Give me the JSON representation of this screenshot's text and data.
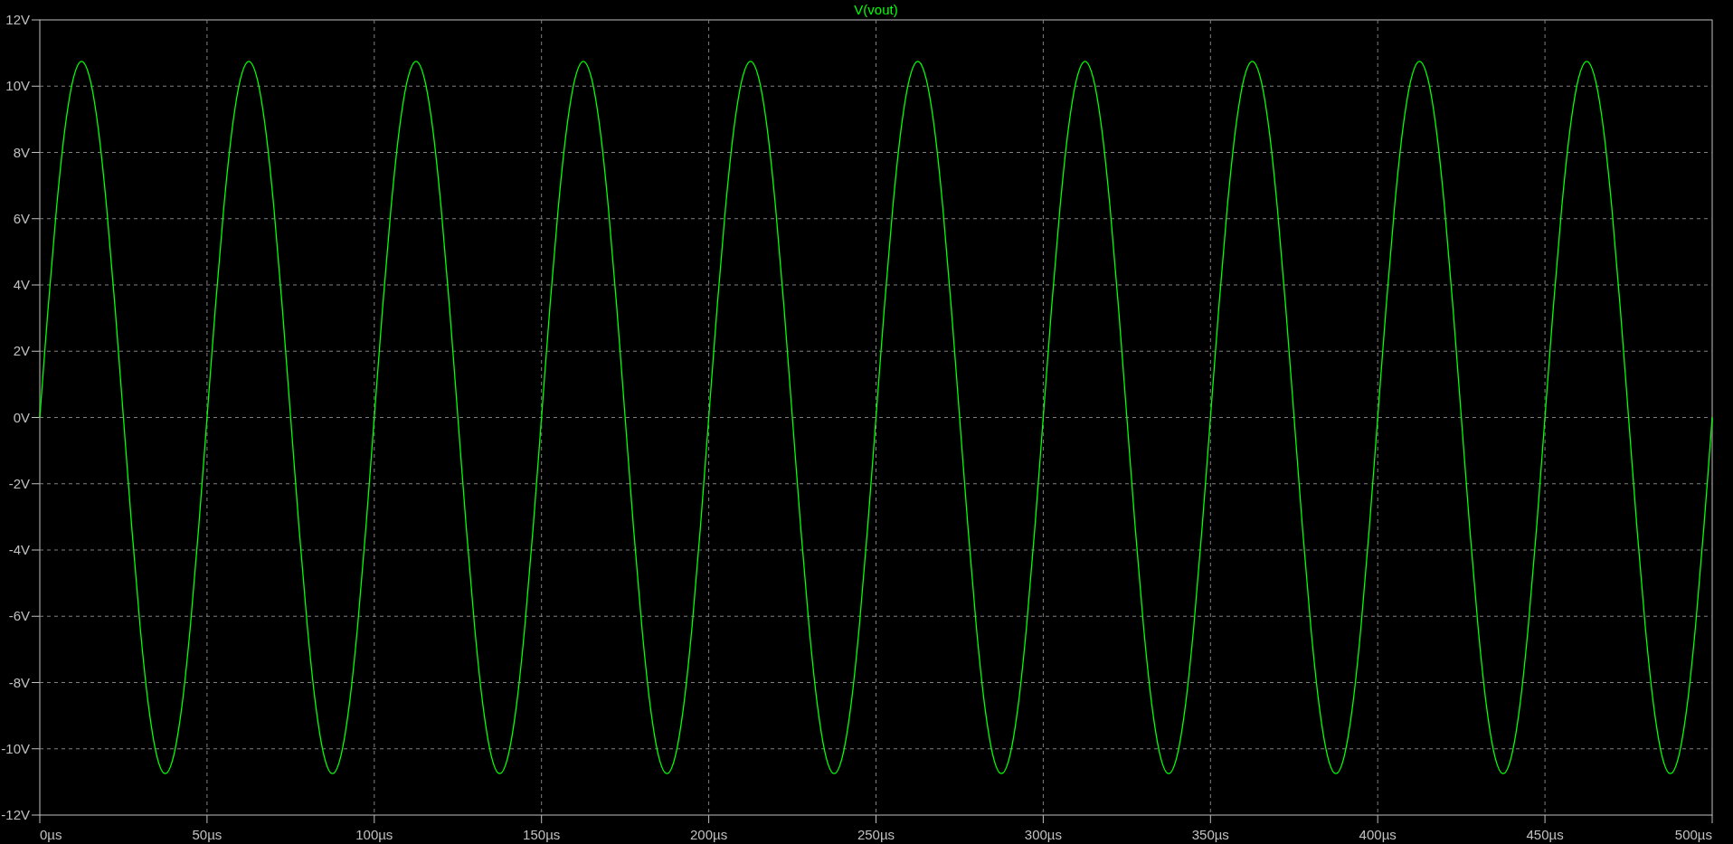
{
  "plot": {
    "chart_data": {
      "type": "line",
      "grid": true,
      "xlim": [
        0,
        500
      ],
      "ylim": [
        -12,
        12
      ],
      "xticks": [
        {
          "value": 0,
          "label": "0µs"
        },
        {
          "value": 50,
          "label": "50µs"
        },
        {
          "value": 100,
          "label": "100µs"
        },
        {
          "value": 150,
          "label": "150µs"
        },
        {
          "value": 200,
          "label": "200µs"
        },
        {
          "value": 250,
          "label": "250µs"
        },
        {
          "value": 300,
          "label": "300µs"
        },
        {
          "value": 350,
          "label": "350µs"
        },
        {
          "value": 400,
          "label": "400µs"
        },
        {
          "value": 450,
          "label": "450µs"
        },
        {
          "value": 500,
          "label": "500µs"
        }
      ],
      "yticks": [
        {
          "value": 12,
          "label": "12V"
        },
        {
          "value": 10,
          "label": "10V"
        },
        {
          "value": 8,
          "label": "8V"
        },
        {
          "value": 6,
          "label": "6V"
        },
        {
          "value": 4,
          "label": "4V"
        },
        {
          "value": 2,
          "label": "2V"
        },
        {
          "value": 0,
          "label": "0V"
        },
        {
          "value": -2,
          "label": "-2V"
        },
        {
          "value": -4,
          "label": "-4V"
        },
        {
          "value": -6,
          "label": "-6V"
        },
        {
          "value": -8,
          "label": "-8V"
        },
        {
          "value": -10,
          "label": "-10V"
        },
        {
          "value": -12,
          "label": "-12V"
        }
      ],
      "x": [
        0,
        2.5,
        5,
        7.5,
        10,
        12.5,
        15,
        17.5,
        20,
        22.5,
        25,
        27.5,
        30,
        32.5,
        35,
        37.5,
        40,
        42.5,
        45,
        47.5,
        50,
        52.5,
        55,
        57.5,
        60,
        62.5,
        65,
        67.5,
        70,
        72.5,
        75,
        77.5,
        80,
        82.5,
        85,
        87.5,
        90,
        92.5,
        95,
        97.5,
        100,
        102.5,
        105,
        107.5,
        110,
        112.5,
        115,
        117.5,
        120,
        122.5,
        125,
        127.5,
        130,
        132.5,
        135,
        137.5,
        140,
        142.5,
        145,
        147.5,
        150,
        152.5,
        155,
        157.5,
        160,
        162.5,
        165,
        167.5,
        170,
        172.5,
        175,
        177.5,
        180,
        182.5,
        185,
        187.5,
        190,
        192.5,
        195,
        197.5,
        200,
        202.5,
        205,
        207.5,
        210,
        212.5,
        215,
        217.5,
        220,
        222.5,
        225,
        227.5,
        230,
        232.5,
        235,
        237.5,
        240,
        242.5,
        245,
        247.5,
        250,
        252.5,
        255,
        257.5,
        260,
        262.5,
        265,
        267.5,
        270,
        272.5,
        275,
        277.5,
        280,
        282.5,
        285,
        287.5,
        290,
        292.5,
        295,
        297.5,
        300,
        302.5,
        305,
        307.5,
        310,
        312.5,
        315,
        317.5,
        320,
        322.5,
        325,
        327.5,
        330,
        332.5,
        335,
        337.5,
        340,
        342.5,
        345,
        347.5,
        350,
        352.5,
        355,
        357.5,
        360,
        362.5,
        365,
        367.5,
        370,
        372.5,
        375,
        377.5,
        380,
        382.5,
        385,
        387.5,
        390,
        392.5,
        395,
        397.5,
        400,
        402.5,
        405,
        407.5,
        410,
        412.5,
        415,
        417.5,
        420,
        422.5,
        425,
        427.5,
        430,
        432.5,
        435,
        437.5,
        440,
        442.5,
        445,
        447.5,
        450,
        452.5,
        455,
        457.5,
        460,
        462.5,
        465,
        467.5,
        470,
        472.5,
        475,
        477.5,
        480,
        482.5,
        485,
        487.5,
        490,
        492.5,
        495,
        497.5,
        500
      ],
      "series": [
        {
          "name": "V(vout)",
          "color": "#00ff00",
          "values": [
            0,
            3.32,
            6.32,
            8.7,
            10.22,
            10.75,
            10.22,
            8.7,
            6.32,
            3.32,
            0,
            -3.32,
            -6.32,
            -8.7,
            -10.22,
            -10.75,
            -10.22,
            -8.7,
            -6.32,
            -3.32,
            0,
            3.32,
            6.32,
            8.7,
            10.22,
            10.75,
            10.22,
            8.7,
            6.32,
            3.32,
            0,
            -3.32,
            -6.32,
            -8.7,
            -10.22,
            -10.75,
            -10.22,
            -8.7,
            -6.32,
            -3.32,
            0,
            3.32,
            6.32,
            8.7,
            10.22,
            10.75,
            10.22,
            8.7,
            6.32,
            3.32,
            0,
            -3.32,
            -6.32,
            -8.7,
            -10.22,
            -10.75,
            -10.22,
            -8.7,
            -6.32,
            -3.32,
            0,
            3.32,
            6.32,
            8.7,
            10.22,
            10.75,
            10.22,
            8.7,
            6.32,
            3.32,
            0,
            -3.32,
            -6.32,
            -8.7,
            -10.22,
            -10.75,
            -10.22,
            -8.7,
            -6.32,
            -3.32,
            0,
            3.32,
            6.32,
            8.7,
            10.22,
            10.75,
            10.22,
            8.7,
            6.32,
            3.32,
            0,
            -3.32,
            -6.32,
            -8.7,
            -10.22,
            -10.75,
            -10.22,
            -8.7,
            -6.32,
            -3.32,
            0,
            3.32,
            6.32,
            8.7,
            10.22,
            10.75,
            10.22,
            8.7,
            6.32,
            3.32,
            0,
            -3.32,
            -6.32,
            -8.7,
            -10.22,
            -10.75,
            -10.22,
            -8.7,
            -6.32,
            -3.32,
            0,
            3.32,
            6.32,
            8.7,
            10.22,
            10.75,
            10.22,
            8.7,
            6.32,
            3.32,
            0,
            -3.32,
            -6.32,
            -8.7,
            -10.22,
            -10.75,
            -10.22,
            -8.7,
            -6.32,
            -3.32,
            0,
            3.32,
            6.32,
            8.7,
            10.22,
            10.75,
            10.22,
            8.7,
            6.32,
            3.32,
            0,
            -3.32,
            -6.32,
            -8.7,
            -10.22,
            -10.75,
            -10.22,
            -8.7,
            -6.32,
            -3.32,
            0,
            3.32,
            6.32,
            8.7,
            10.22,
            10.75,
            10.22,
            8.7,
            6.32,
            3.32,
            0,
            -3.32,
            -6.32,
            -8.7,
            -10.22,
            -10.75,
            -10.22,
            -8.7,
            -6.32,
            -3.32,
            0,
            3.32,
            6.32,
            8.7,
            10.22,
            10.75,
            10.22,
            8.7,
            6.32,
            3.32,
            0,
            -3.32,
            -6.32,
            -8.7,
            -10.22,
            -10.75,
            -10.22,
            -8.7,
            -6.32,
            -3.32,
            0
          ]
        }
      ]
    }
  }
}
